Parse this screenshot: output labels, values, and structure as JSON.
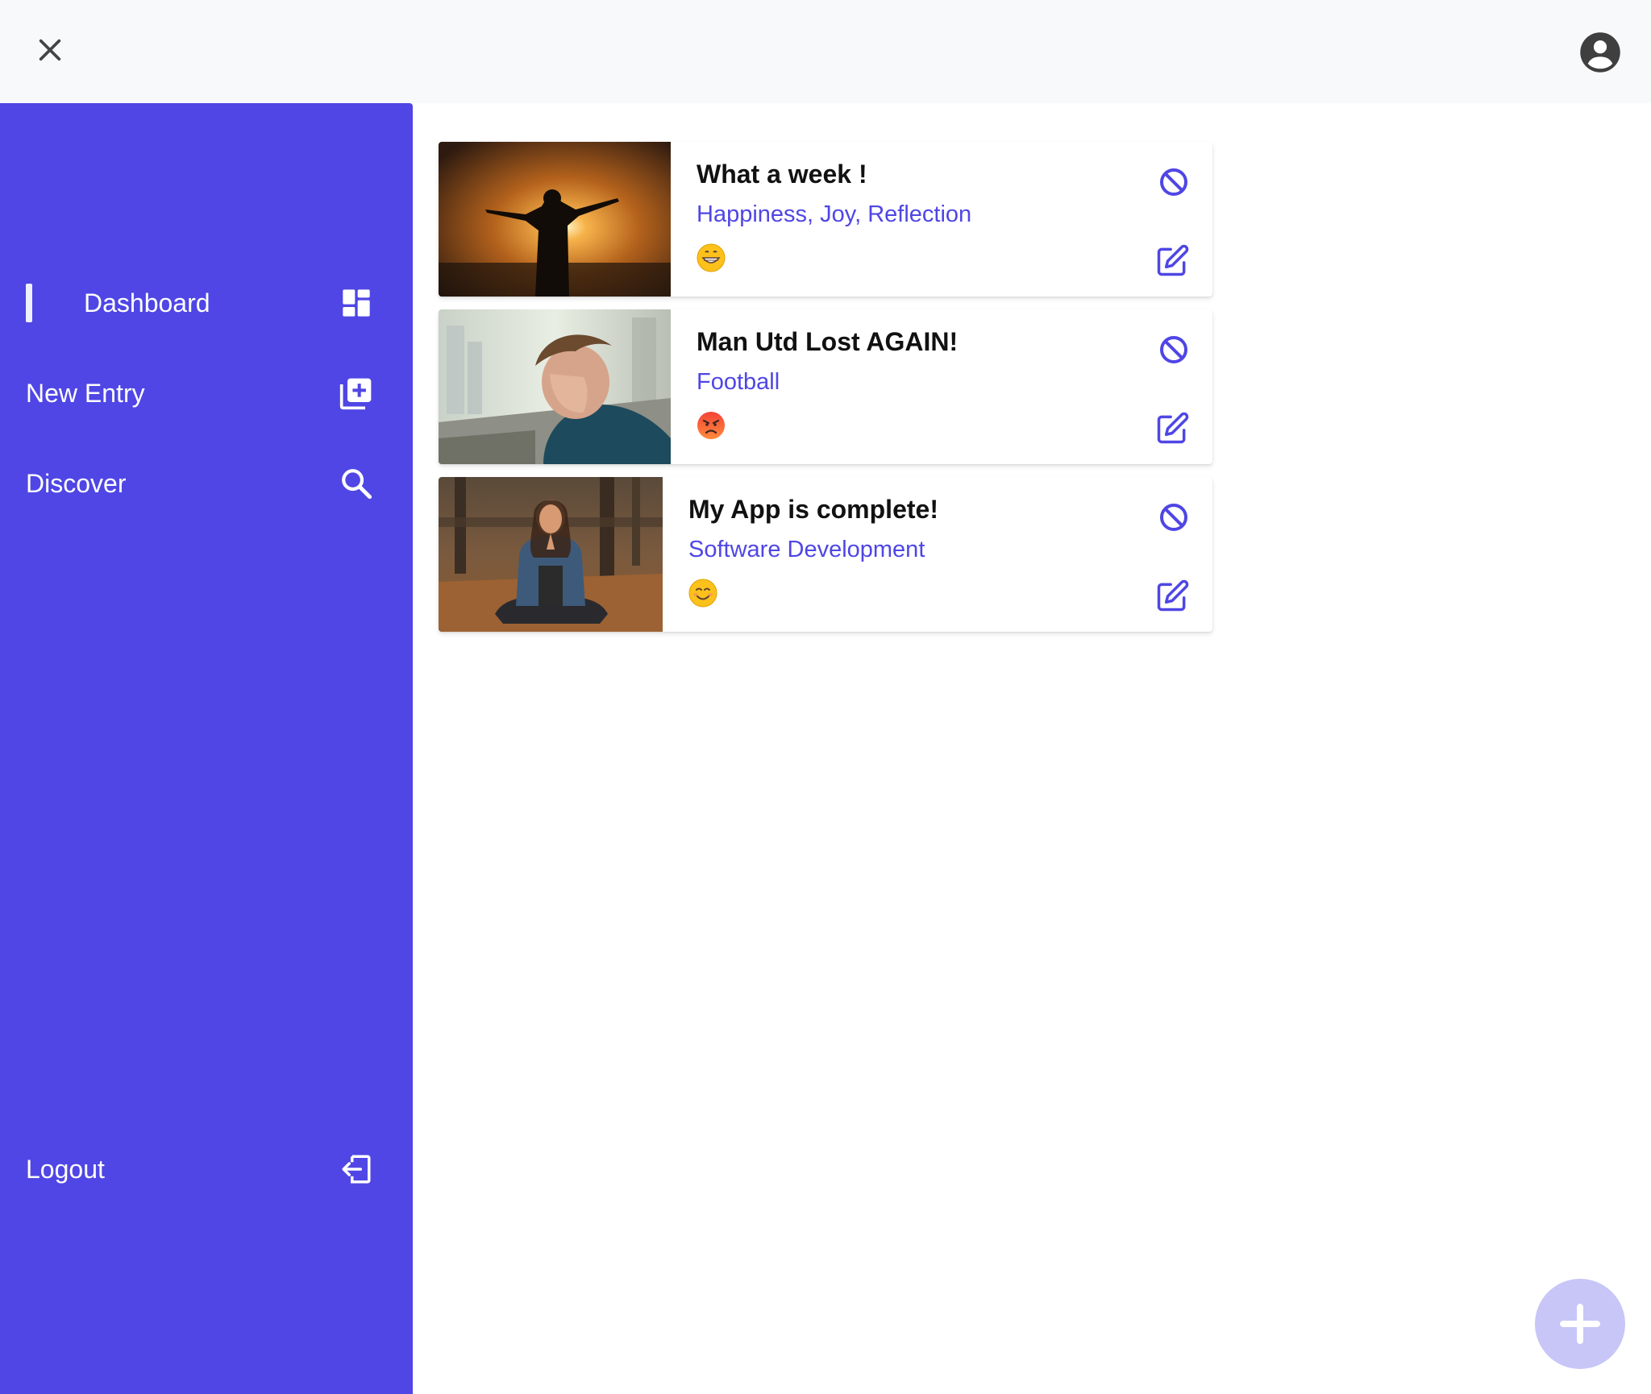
{
  "header": {
    "close_icon": "close-icon",
    "account_icon": "account-circle-icon"
  },
  "sidebar": {
    "items": [
      {
        "label": "Dashboard",
        "icon": "dashboard-icon",
        "active": true
      },
      {
        "label": "New Entry",
        "icon": "add-box-icon",
        "active": false
      },
      {
        "label": "Discover",
        "icon": "search-icon",
        "active": false
      }
    ],
    "logout": {
      "label": "Logout",
      "icon": "logout-icon"
    }
  },
  "entries": [
    {
      "title": "What a week !",
      "tags": "Happiness, Joy, Reflection",
      "mood": "grinning-face-emoji"
    },
    {
      "title": "Man Utd Lost AGAIN!",
      "tags": "Football",
      "mood": "angry-face-emoji"
    },
    {
      "title": "My App is complete!",
      "tags": "Software Development",
      "mood": "smiling-face-emoji"
    }
  ],
  "colors": {
    "primary": "#4f46e5",
    "fab": "#c7c6f7",
    "topbar": "#f8f9fb"
  },
  "fab": {
    "icon": "plus-icon"
  }
}
